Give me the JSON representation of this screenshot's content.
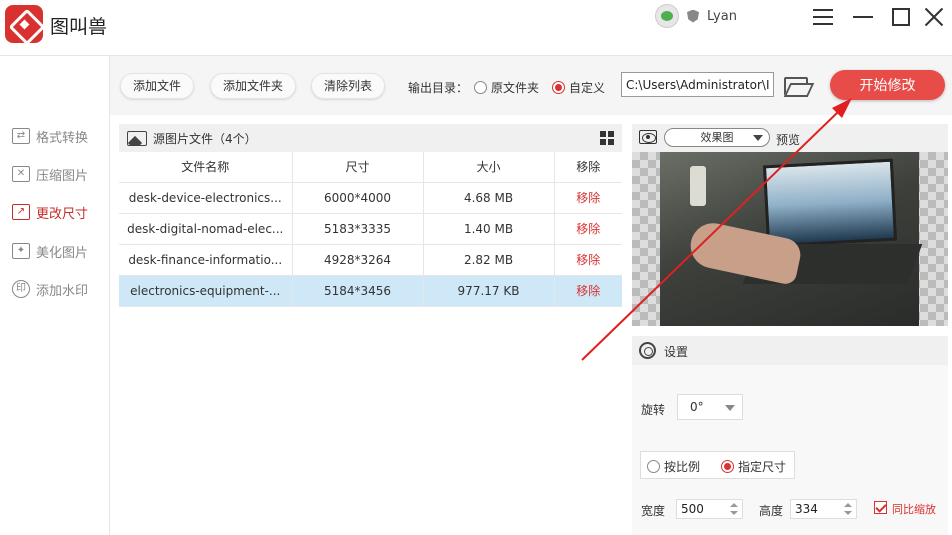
{
  "app": {
    "title": "图叫兽"
  },
  "user": {
    "name": "Lyan"
  },
  "sidebar": {
    "items": [
      {
        "label": "格式转换",
        "icon": "convert-icon"
      },
      {
        "label": "压缩图片",
        "icon": "compress-icon"
      },
      {
        "label": "更改尺寸",
        "icon": "resize-icon",
        "active": true
      },
      {
        "label": "美化图片",
        "icon": "beautify-icon"
      },
      {
        "label": "添加水印",
        "icon": "watermark-icon"
      }
    ]
  },
  "toolbar": {
    "add_file": "添加文件",
    "add_folder": "添加文件夹",
    "clear_list": "清除列表",
    "output_label": "输出目录：",
    "opt_original": "原文件夹",
    "opt_custom": "自定义",
    "output_path": "C:\\Users\\Administrator\\I",
    "start": "开始修改"
  },
  "filelist": {
    "title": "源图片文件（4个）",
    "columns": [
      "文件名称",
      "尺寸",
      "大小",
      "移除"
    ],
    "rows": [
      {
        "name": "desk-device-electronics...",
        "dims": "6000*4000",
        "size": "4.68 MB",
        "remove": "移除"
      },
      {
        "name": "desk-digital-nomad-elec...",
        "dims": "5183*3335",
        "size": "1.40 MB",
        "remove": "移除"
      },
      {
        "name": "desk-finance-informatio...",
        "dims": "4928*3264",
        "size": "2.82 MB",
        "remove": "移除"
      },
      {
        "name": "electronics-equipment-...",
        "dims": "5184*3456",
        "size": "977.17 KB",
        "remove": "移除",
        "selected": true
      }
    ]
  },
  "preview": {
    "effect_value": "效果图",
    "label": "预览"
  },
  "settings": {
    "title": "设置",
    "rotate_label": "旋转",
    "rotate_value": "0°",
    "mode_ratio": "按比例",
    "mode_size": "指定尺寸",
    "width_label": "宽度",
    "width_value": "500",
    "height_label": "高度",
    "height_value": "334",
    "keep_ratio": "同比缩放"
  },
  "colors": {
    "accent": "#e84c48",
    "remove": "#d8312f",
    "selected_row": "#cfe8f7"
  }
}
